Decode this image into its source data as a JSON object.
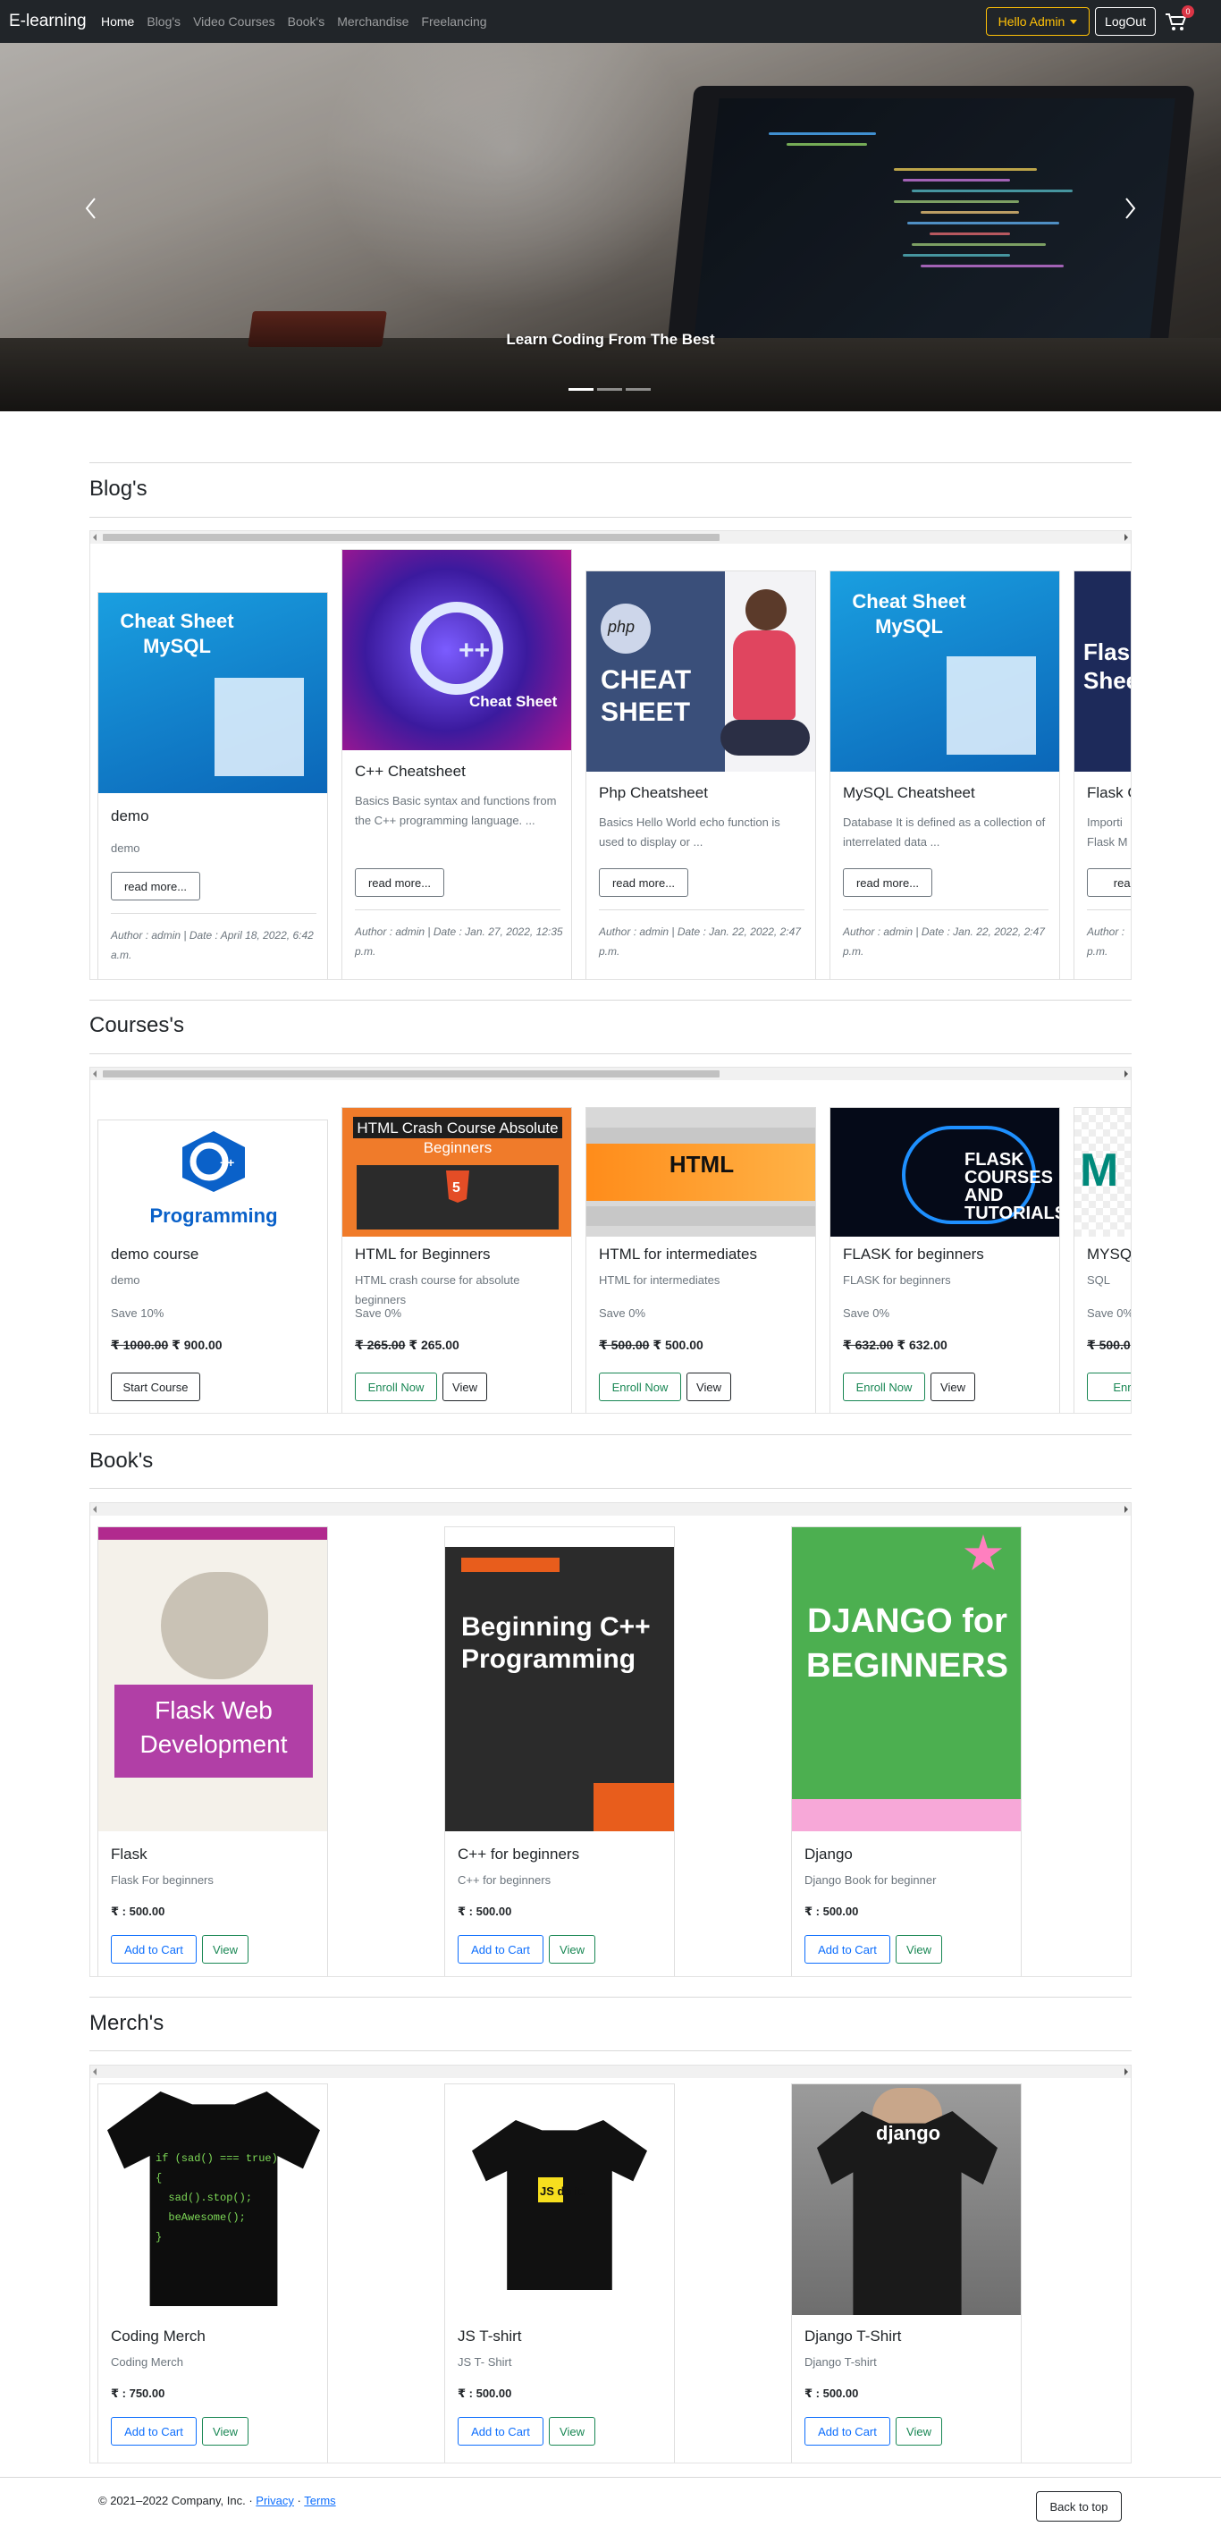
{
  "navbar": {
    "brand": "E-learning",
    "links": [
      "Home",
      "Blog's",
      "Video Courses",
      "Book's",
      "Merchandise",
      "Freelancing"
    ],
    "hello_label": "Hello Admin",
    "logout_label": "LogOut",
    "cart_count": "0"
  },
  "hero": {
    "caption": "Learn Coding From The Best",
    "slides": 3,
    "active_slide": 1
  },
  "blogs": {
    "title": "Blog's",
    "items": [
      {
        "title": "demo",
        "text": "demo",
        "button": "read more...",
        "meta": "Author : admin | Date : April 18, 2022, 6:42 a.m.",
        "image_text": "Cheat Sheet MySQL"
      },
      {
        "title": "C++ Cheatsheet",
        "text": "Basics Basic syntax and functions from the C++ programming language. ...",
        "button": "read more...",
        "meta": "Author : admin | Date : Jan. 27, 2022, 12:35 p.m.",
        "image_text": "Cheat Sheet"
      },
      {
        "title": "Php Cheatsheet",
        "text": "Basics Hello World echo function is used to display or ...",
        "button": "read more...",
        "meta": "Author : admin | Date : Jan. 22, 2022, 2:47 p.m.",
        "image_text": "CHEAT SHEET"
      },
      {
        "title": "MySQL Cheatsheet",
        "text": "Database It is defined as a collection of interrelated data ...",
        "button": "read more...",
        "meta": "Author : admin | Date : Jan. 22, 2022, 2:47 p.m.",
        "image_text": "Cheat Sheet MySQL"
      },
      {
        "title": "Flask C",
        "text": "Importi Flask M",
        "button": "read m",
        "meta": "Author : p.m.",
        "image_text": "Flask Shee"
      }
    ]
  },
  "courses": {
    "title": "Courses's",
    "items": [
      {
        "title": "demo course",
        "text": "demo",
        "save": "Save 10%",
        "old_price": "₹ 1000.00",
        "price": "₹ 900.00",
        "button": "Start Course",
        "view": "",
        "image_text": "Programming"
      },
      {
        "title": "HTML for Beginners",
        "text": "HTML crash course for absolute beginners",
        "save": "Save 0%",
        "old_price": "₹ 265.00",
        "price": "₹ 265.00",
        "button": "Enroll Now",
        "view": "View",
        "image_text": "HTML Crash Course Absolute Beginners"
      },
      {
        "title": "HTML for intermediates",
        "text": "HTML for intermediates",
        "save": "Save 0%",
        "old_price": "₹ 500.00",
        "price": "₹ 500.00",
        "button": "Enroll Now",
        "view": "View",
        "image_text": "HTML"
      },
      {
        "title": "FLASK for beginners",
        "text": "FLASK for beginners",
        "save": "Save 0%",
        "old_price": "₹ 632.00",
        "price": "₹ 632.00",
        "button": "Enroll Now",
        "view": "View",
        "image_text": "FLASK COURSES AND TUTORIALS"
      },
      {
        "title": "MYSQ",
        "text": "SQL",
        "save": "Save 0%",
        "old_price": "₹ 500.0",
        "price": "",
        "button": "Enroll",
        "view": "",
        "image_text": "M"
      }
    ]
  },
  "books": {
    "title": "Book's",
    "items": [
      {
        "title": "Flask",
        "text": "Flask For beginners",
        "price": "₹ : 500.00",
        "cart": "Add to Cart",
        "view": "View",
        "image_text": "Flask Web Development"
      },
      {
        "title": "C++ for beginners",
        "text": "C++ for beginners",
        "price": "₹ : 500.00",
        "cart": "Add to Cart",
        "view": "View",
        "image_text": "Beginning C++ Programming"
      },
      {
        "title": "Django",
        "text": "Django Book for beginner",
        "price": "₹ : 500.00",
        "cart": "Add to Cart",
        "view": "View",
        "image_text": "DJANGO for BEGINNERS"
      }
    ]
  },
  "merch": {
    "title": "Merch's",
    "items": [
      {
        "title": "Coding Merch",
        "text": "Coding Merch",
        "price": "₹ : 750.00",
        "cart": "Add to Cart",
        "view": "View"
      },
      {
        "title": "JS T-shirt",
        "text": "JS T- Shirt",
        "price": "₹ : 500.00",
        "cart": "Add to Cart",
        "view": "View",
        "image_text": "JS do it."
      },
      {
        "title": "Django T-Shirt",
        "text": "Django T-shirt",
        "price": "₹ : 500.00",
        "cart": "Add to Cart",
        "view": "View",
        "image_text": "django"
      }
    ]
  },
  "footer": {
    "copyright": "© 2021–2022 Company, Inc. ·",
    "privacy": "Privacy",
    "dot": "·",
    "terms": "Terms",
    "back_to_top": "Back to top"
  },
  "colors": {
    "navbar_bg": "#212529",
    "warning": "#ffc107",
    "success": "#198754",
    "primary": "#0d6efd",
    "danger": "#dc3545"
  }
}
